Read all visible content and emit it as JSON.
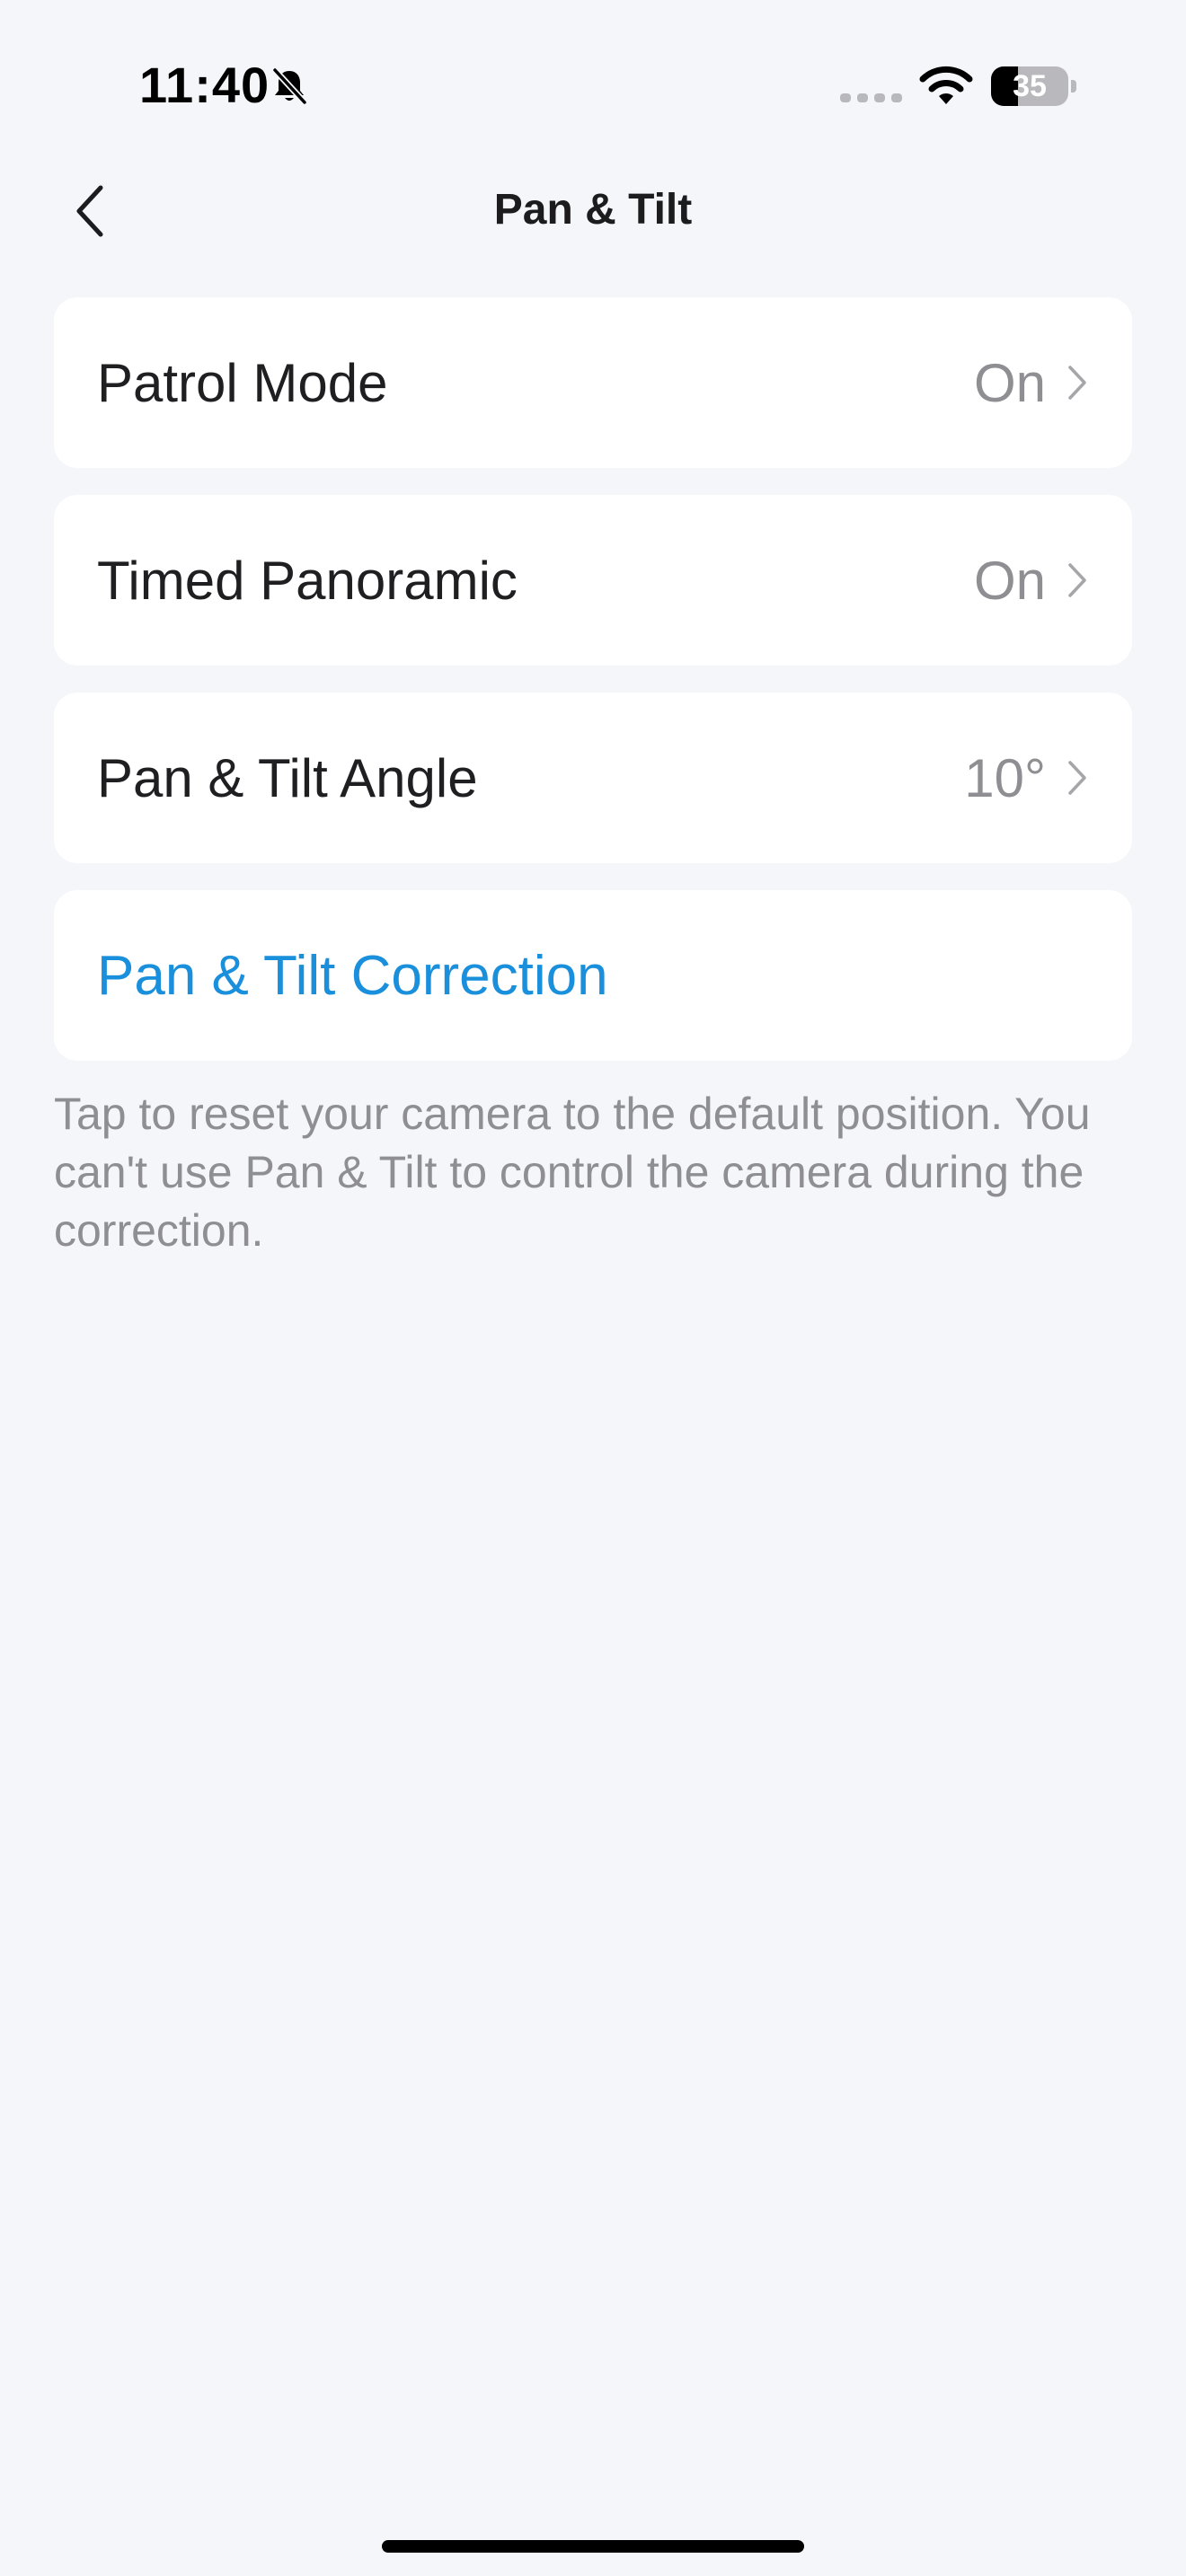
{
  "status_bar": {
    "time": "11:40",
    "battery_level": "35",
    "battery_fraction": 0.35
  },
  "nav": {
    "title": "Pan & Tilt"
  },
  "settings": [
    {
      "label": "Patrol Mode",
      "value": "On"
    },
    {
      "label": "Timed Panoramic",
      "value": "On"
    },
    {
      "label": "Pan & Tilt Angle",
      "value": "10°"
    }
  ],
  "correction": {
    "label": "Pan & Tilt Correction",
    "description": "Tap to reset your camera to the default position. You can't use Pan & Tilt to control the camera during the correction."
  },
  "colors": {
    "background": "#f5f6fa",
    "card": "#ffffff",
    "accent": "#1a8fdc",
    "secondary_text": "#8e8e93"
  },
  "icons": {
    "back": "chevron-left-icon",
    "row_disclosure": "chevron-right-icon",
    "silent": "bell-slash-icon",
    "signal": "cellular-signal-icon",
    "wifi": "wifi-icon",
    "battery": "battery-icon"
  }
}
